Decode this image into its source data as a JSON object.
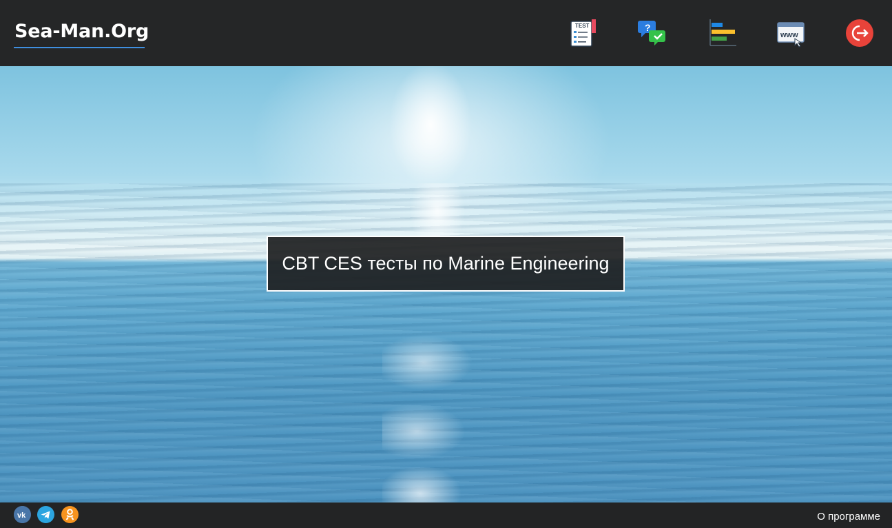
{
  "header": {
    "logo": "Sea-Man.Org",
    "nav": [
      {
        "icon": "test-icon"
      },
      {
        "icon": "question-answer-icon"
      },
      {
        "icon": "statistics-icon"
      },
      {
        "icon": "website-icon"
      },
      {
        "icon": "logout-icon"
      }
    ],
    "test_icon_text": "TEST",
    "website_icon_text": "www"
  },
  "hero": {
    "title": "CBT CES тесты по Marine Engineering"
  },
  "footer": {
    "social": [
      {
        "icon": "vk-icon",
        "color": "#4a76a8"
      },
      {
        "icon": "telegram-icon",
        "color": "#2ca5e0"
      },
      {
        "icon": "odnoklassniki-icon",
        "color": "#f7931e"
      }
    ],
    "about": "О программе"
  },
  "colors": {
    "topbar": "#252627",
    "accent_underline": "#3f8fe0",
    "logout": "#e8433a",
    "footer": "#232425"
  }
}
